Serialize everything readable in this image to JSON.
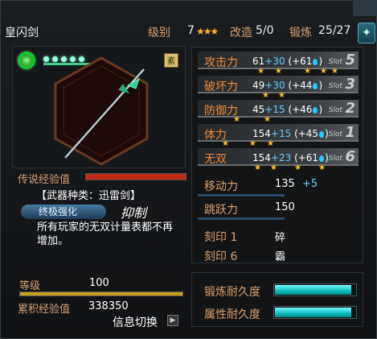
{
  "header": {
    "title": "皇闪剑",
    "level_label": "级别",
    "level_value": "7",
    "mod_label": "改造",
    "mod_value": "5/0",
    "refine_label": "锻炼",
    "refine_value": "25/27",
    "close_glyph": "✦"
  },
  "weapon": {
    "badge": "紊",
    "legend_exp_label": "传说经验值",
    "type_line": "【武器种类：迅雷剑】",
    "ultimate_label": "终极强化",
    "suppress_label": "抑制",
    "description": "所有玩家的无双计量表都不再增加。"
  },
  "stats": [
    {
      "name": "攻击力",
      "base": "61",
      "plus": "+30",
      "paren": "(+61",
      "slot_label": "Slot",
      "slot": "5"
    },
    {
      "name": "破坏力",
      "base": "49",
      "plus": "+30",
      "paren": "(+44",
      "slot_label": "Slot",
      "slot": "3"
    },
    {
      "name": "防御力",
      "base": "45",
      "plus": "+15",
      "paren": "(+46",
      "slot_label": "Slot",
      "slot": "2"
    },
    {
      "name": "体力",
      "base": "154",
      "plus": "+15",
      "paren": "(+45",
      "slot_label": "Slot",
      "slot": "1"
    },
    {
      "name": "无双",
      "base": "154",
      "plus": "+23",
      "paren": "(+61",
      "slot_label": "Slot",
      "slot": "6"
    }
  ],
  "move": {
    "label": "移动力",
    "value": "135",
    "bonus": "+5"
  },
  "jump": {
    "label": "跳跃力",
    "value": "150"
  },
  "seals": [
    {
      "label": "刻印 1",
      "value": "碎"
    },
    {
      "label": "刻印 6",
      "value": "霸"
    }
  ],
  "level": {
    "label": "等级",
    "value": "100"
  },
  "exp": {
    "label": "累积经验值",
    "value": "338350"
  },
  "switch_label": "信息切换",
  "durability": [
    {
      "label": "锻炼耐久度",
      "fill": 0.95
    },
    {
      "label": "属性耐久度",
      "fill": 0.95
    }
  ],
  "colors": {
    "accent": "#f08a38",
    "bonus": "#66ccff",
    "durability": "#22bbbb"
  }
}
